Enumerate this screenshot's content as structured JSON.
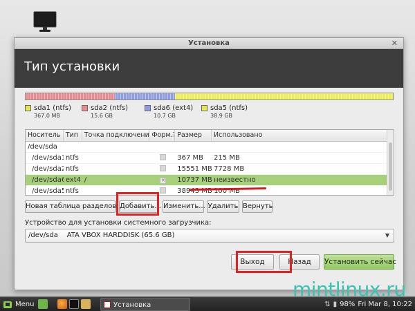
{
  "window": {
    "title": "Установка",
    "close_glyph": "✕"
  },
  "header": {
    "title": "Тип установки"
  },
  "partition_bar": {
    "segments": [
      {
        "name": "sda1",
        "color": "#e8888f",
        "fraction": 0.005
      },
      {
        "name": "sda2",
        "color": "#e8888f",
        "fraction": 0.238
      },
      {
        "name": "sda6",
        "color": "#8e9ee6",
        "fraction": 0.164
      },
      {
        "name": "sda5",
        "color": "#eded5a",
        "fraction": 0.593
      }
    ]
  },
  "legend": [
    {
      "label": "sda1 (ntfs)",
      "size": "367.0 MB",
      "color": "#e6e64e"
    },
    {
      "label": "sda2 (ntfs)",
      "size": "15.6 GB",
      "color": "#e88c8c"
    },
    {
      "label": "sda6 (ext4)",
      "size": "10.7 GB",
      "color": "#8d9ce4"
    },
    {
      "label": "sda5 (ntfs)",
      "size": "38.9 GB",
      "color": "#e6e64e"
    }
  ],
  "table": {
    "headers": [
      "Носитель",
      "Тип",
      "Точка подключения",
      "Форм.?",
      "Размер",
      "Использовано"
    ],
    "rows": [
      {
        "device": "/dev/sda",
        "type": "",
        "mount": "",
        "size": "",
        "used": "",
        "check": "none"
      },
      {
        "device": "/dev/sda1",
        "type": "ntfs",
        "mount": "",
        "size": "367 MB",
        "used": "215 MB",
        "check": "off"
      },
      {
        "device": "/dev/sda2",
        "type": "ntfs",
        "mount": "",
        "size": "15551 MB",
        "used": "7728 MB",
        "check": "off"
      },
      {
        "device": "/dev/sda6",
        "type": "ext4",
        "mount": "/",
        "size": "10737 MB",
        "used": "неизвестно",
        "check": "on"
      },
      {
        "device": "/dev/sda5",
        "type": "ntfs",
        "mount": "",
        "size": "38943 MB",
        "used": "100 MB",
        "check": "off"
      }
    ],
    "selected_row": 3
  },
  "partition_buttons": {
    "new_table": "Новая таблица разделов...",
    "add": "Добавить...",
    "change": "Изменить...",
    "delete": "Удалить",
    "revert": "Вернуть"
  },
  "bootloader": {
    "label": "Устройство для установки системного загрузчика:",
    "device": "/dev/sda",
    "description": "ATA VBOX HARDDISK (65.6 GB)"
  },
  "nav_buttons": {
    "quit": "Выход",
    "back": "Назад",
    "install": "Установить сейчас"
  },
  "watermark": "mintlinux.ru",
  "taskbar": {
    "menu_label": "Menu",
    "task_label": "Установка",
    "battery": "98%",
    "clock": "Fri Mar  8, 10:22"
  }
}
